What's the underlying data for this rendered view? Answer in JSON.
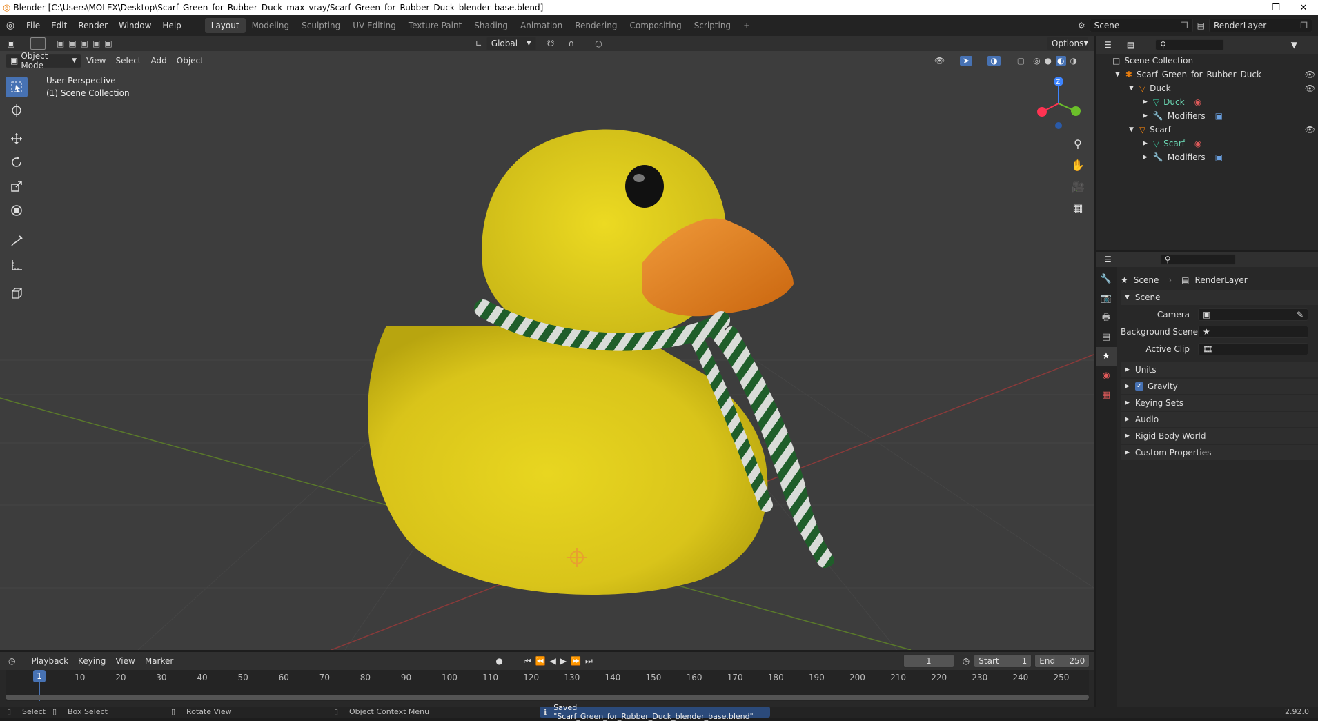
{
  "window": {
    "title": "Blender [C:\\Users\\MOLEX\\Desktop\\Scarf_Green_for_Rubber_Duck_max_vray/Scarf_Green_for_Rubber_Duck_blender_base.blend]",
    "minimize": "–",
    "maximize": "❐",
    "close": "✕"
  },
  "menus": [
    "File",
    "Edit",
    "Render",
    "Window",
    "Help"
  ],
  "workspaces": [
    "Layout",
    "Modeling",
    "Sculpting",
    "UV Editing",
    "Texture Paint",
    "Shading",
    "Animation",
    "Rendering",
    "Compositing",
    "Scripting"
  ],
  "active_workspace": "Layout",
  "scene_field": "Scene",
  "view_layer_field": "RenderLayer",
  "viewport": {
    "transform_orientation": "Global",
    "options_label": "Options",
    "mode": "Object Mode",
    "header_menus": [
      "View",
      "Select",
      "Add",
      "Object"
    ],
    "overlay_line1": "User Perspective",
    "overlay_line2": "(1) Scene Collection",
    "gizmo_axis": "Z"
  },
  "outliner": {
    "rows": [
      {
        "label": "Scene Collection"
      },
      {
        "label": "Scarf_Green_for_Rubber_Duck"
      },
      {
        "label": "Duck"
      },
      {
        "label": "Duck"
      },
      {
        "label": "Modifiers"
      },
      {
        "label": "Scarf"
      },
      {
        "label": "Scarf"
      },
      {
        "label": "Modifiers"
      }
    ]
  },
  "properties": {
    "breadcrumb_scene": "Scene",
    "breadcrumb_layer": "RenderLayer",
    "panel_title": "Scene",
    "fields": [
      {
        "label": "Camera",
        "value": ""
      },
      {
        "label": "Background Scene",
        "value": ""
      },
      {
        "label": "Active Clip",
        "value": ""
      }
    ],
    "subpanels": [
      "Units",
      "Gravity",
      "Keying Sets",
      "Audio",
      "Rigid Body World",
      "Custom Properties"
    ],
    "gravity_checked": true
  },
  "timeline": {
    "menus": [
      "Playback",
      "Keying",
      "View",
      "Marker"
    ],
    "current_frame": "1",
    "start_label": "Start",
    "start_value": "1",
    "end_label": "End",
    "end_value": "250",
    "ticks": [
      "10",
      "20",
      "30",
      "40",
      "50",
      "60",
      "70",
      "80",
      "90",
      "100",
      "110",
      "120",
      "130",
      "140",
      "150",
      "160",
      "170",
      "180",
      "190",
      "200",
      "210",
      "220",
      "230",
      "240",
      "250"
    ],
    "playhead": "1"
  },
  "statusbar": {
    "select": "Select",
    "box_select": "Box Select",
    "rotate_view": "Rotate View",
    "context_menu": "Object Context Menu",
    "message": "Saved \"Scarf_Green_for_Rubber_Duck_blender_base.blend\"",
    "version": "2.92.0"
  },
  "colors": {
    "accent": "#4772b3",
    "duck_yellow": "#e6d21c",
    "beak": "#e07a1c",
    "scarf_green": "#1f6b2c"
  }
}
